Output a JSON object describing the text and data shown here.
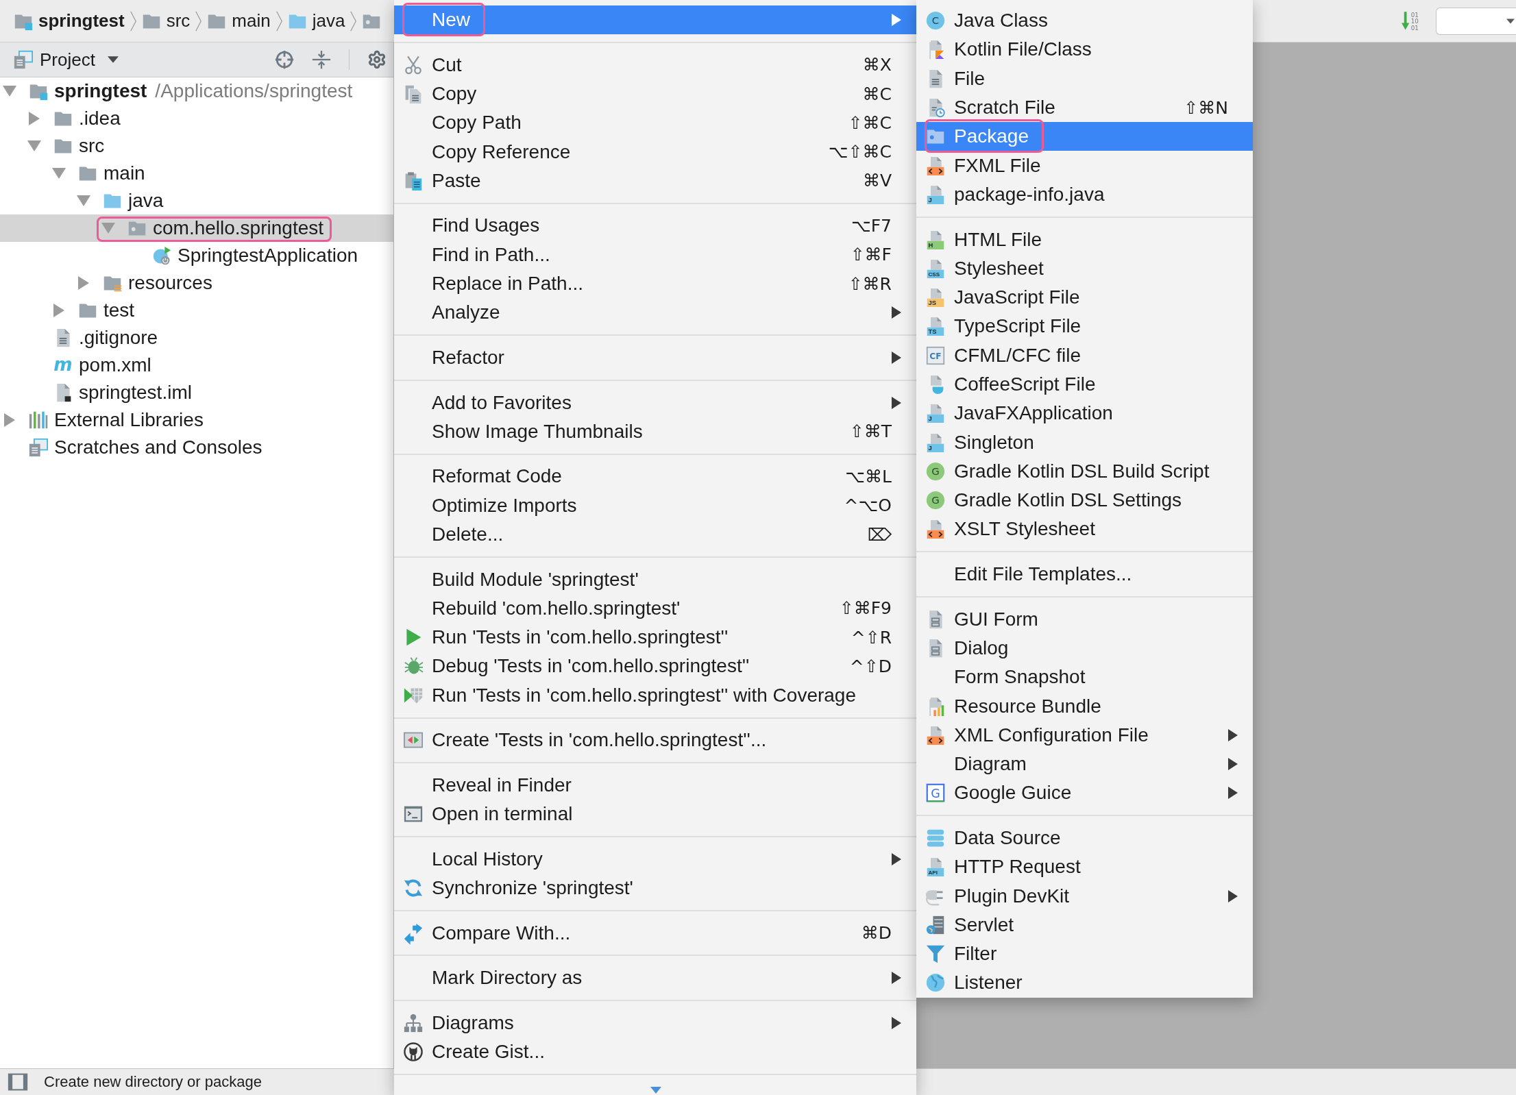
{
  "navigation_bar": {
    "breadcrumbs": [
      {
        "label": "springtest",
        "kind": "module"
      },
      {
        "label": "src",
        "kind": "folder"
      },
      {
        "label": "main",
        "kind": "folder"
      },
      {
        "label": "java",
        "kind": "source-folder"
      }
    ],
    "sort_icon_digits": [
      "01",
      "10",
      "01"
    ]
  },
  "project_panel": {
    "title": "Project",
    "tree": [
      {
        "label": "springtest",
        "path": "/Applications/springtest",
        "kind": "module",
        "expanded": true,
        "selected": false,
        "highlighted": false,
        "children": [
          {
            "label": ".idea",
            "kind": "folder",
            "expanded": false,
            "selected": false,
            "highlighted": false
          },
          {
            "label": "src",
            "kind": "folder",
            "expanded": true,
            "selected": false,
            "highlighted": false,
            "children": [
              {
                "label": "main",
                "kind": "folder",
                "expanded": true,
                "selected": false,
                "highlighted": false,
                "children": [
                  {
                    "label": "java",
                    "kind": "source-folder",
                    "expanded": true,
                    "selected": false,
                    "highlighted": false,
                    "children": [
                      {
                        "label": "com.hello.springtest",
                        "kind": "package",
                        "expanded": true,
                        "selected": true,
                        "highlighted": true,
                        "children": [
                          {
                            "label": "SpringtestApplication",
                            "kind": "spring-class",
                            "selected": false,
                            "highlighted": false
                          }
                        ]
                      }
                    ]
                  },
                  {
                    "label": "resources",
                    "kind": "resources-folder",
                    "expanded": false,
                    "selected": false,
                    "highlighted": false
                  }
                ]
              },
              {
                "label": "test",
                "kind": "folder",
                "expanded": false,
                "selected": false,
                "highlighted": false
              }
            ]
          },
          {
            "label": ".gitignore",
            "kind": "text-file",
            "selected": false,
            "highlighted": false
          },
          {
            "label": "pom.xml",
            "kind": "maven",
            "icon_label": "m",
            "selected": false,
            "highlighted": false
          },
          {
            "label": "springtest.iml",
            "kind": "module-file",
            "selected": false,
            "highlighted": false
          }
        ]
      },
      {
        "label": "External Libraries",
        "kind": "libraries",
        "expanded": false,
        "selected": false,
        "highlighted": false
      },
      {
        "label": "Scratches and Consoles",
        "kind": "scratches",
        "selected": false,
        "highlighted": false
      }
    ]
  },
  "context_menu": {
    "groups": [
      [
        {
          "label": "New",
          "submenu": true,
          "selected": true,
          "highlighted": true
        }
      ],
      [
        {
          "label": "Cut",
          "shortcut": "⌘X",
          "submenu": false,
          "selected": false,
          "highlighted": false
        },
        {
          "label": "Copy",
          "shortcut": "⌘C",
          "submenu": false,
          "selected": false,
          "highlighted": false
        },
        {
          "label": "Copy Path",
          "shortcut": "⇧⌘C",
          "submenu": false,
          "selected": false,
          "highlighted": false
        },
        {
          "label": "Copy Reference",
          "shortcut": "⌥⇧⌘C",
          "submenu": false,
          "selected": false,
          "highlighted": false
        },
        {
          "label": "Paste",
          "shortcut": "⌘V",
          "submenu": false,
          "selected": false,
          "highlighted": false
        }
      ],
      [
        {
          "label": "Find Usages",
          "shortcut": "⌥F7",
          "submenu": false,
          "selected": false,
          "highlighted": false
        },
        {
          "label": "Find in Path...",
          "shortcut": "⇧⌘F",
          "submenu": false,
          "selected": false,
          "highlighted": false
        },
        {
          "label": "Replace in Path...",
          "shortcut": "⇧⌘R",
          "submenu": false,
          "selected": false,
          "highlighted": false
        },
        {
          "label": "Analyze",
          "submenu": true,
          "selected": false,
          "highlighted": false
        }
      ],
      [
        {
          "label": "Refactor",
          "submenu": true,
          "selected": false,
          "highlighted": false
        }
      ],
      [
        {
          "label": "Add to Favorites",
          "submenu": true,
          "selected": false,
          "highlighted": false
        },
        {
          "label": "Show Image Thumbnails",
          "shortcut": "⇧⌘T",
          "submenu": false,
          "selected": false,
          "highlighted": false
        }
      ],
      [
        {
          "label": "Reformat Code",
          "shortcut": "⌥⌘L",
          "submenu": false,
          "selected": false,
          "highlighted": false
        },
        {
          "label": "Optimize Imports",
          "shortcut": "^⌥O",
          "submenu": false,
          "selected": false,
          "highlighted": false
        },
        {
          "label": "Delete...",
          "shortcut": "⌦",
          "submenu": false,
          "selected": false,
          "highlighted": false
        }
      ],
      [
        {
          "label": "Build Module 'springtest'",
          "submenu": false,
          "selected": false,
          "highlighted": false
        },
        {
          "label": "Rebuild 'com.hello.springtest'",
          "shortcut": "⇧⌘F9",
          "submenu": false,
          "selected": false,
          "highlighted": false
        },
        {
          "label": "Run 'Tests in 'com.hello.springtest''",
          "shortcut": "^⇧R",
          "submenu": false,
          "selected": false,
          "highlighted": false
        },
        {
          "label": "Debug 'Tests in 'com.hello.springtest''",
          "shortcut": "^⇧D",
          "submenu": false,
          "selected": false,
          "highlighted": false
        },
        {
          "label": "Run 'Tests in 'com.hello.springtest'' with Coverage",
          "submenu": false,
          "selected": false,
          "highlighted": false
        }
      ],
      [
        {
          "label": "Create 'Tests in 'com.hello.springtest''...",
          "submenu": false,
          "selected": false,
          "highlighted": false
        }
      ],
      [
        {
          "label": "Reveal in Finder",
          "submenu": false,
          "selected": false,
          "highlighted": false
        },
        {
          "label": "Open in terminal",
          "submenu": false,
          "selected": false,
          "highlighted": false
        }
      ],
      [
        {
          "label": "Local History",
          "submenu": true,
          "selected": false,
          "highlighted": false
        },
        {
          "label": "Synchronize 'springtest'",
          "submenu": false,
          "selected": false,
          "highlighted": false
        }
      ],
      [
        {
          "label": "Compare With...",
          "shortcut": "⌘D",
          "submenu": false,
          "selected": false,
          "highlighted": false
        }
      ],
      [
        {
          "label": "Mark Directory as",
          "submenu": true,
          "selected": false,
          "highlighted": false
        }
      ],
      [
        {
          "label": "Diagrams",
          "submenu": true,
          "selected": false,
          "highlighted": false
        },
        {
          "label": "Create Gist...",
          "submenu": false,
          "selected": false,
          "highlighted": false
        }
      ]
    ]
  },
  "new_submenu": {
    "groups": [
      [
        {
          "label": "Java Class",
          "icon_label": "C",
          "submenu": false,
          "selected": false,
          "highlighted": false
        },
        {
          "label": "Kotlin File/Class",
          "submenu": false,
          "selected": false,
          "highlighted": false
        },
        {
          "label": "File",
          "submenu": false,
          "selected": false,
          "highlighted": false
        },
        {
          "label": "Scratch File",
          "shortcut": "⇧⌘N",
          "submenu": false,
          "selected": false,
          "highlighted": false
        },
        {
          "label": "Package",
          "submenu": false,
          "selected": true,
          "highlighted": true
        },
        {
          "label": "FXML File",
          "submenu": false,
          "selected": false,
          "highlighted": false
        },
        {
          "label": "package-info.java",
          "icon_label": "J",
          "submenu": false,
          "selected": false,
          "highlighted": false
        }
      ],
      [
        {
          "label": "HTML File",
          "icon_label": "H",
          "submenu": false,
          "selected": false,
          "highlighted": false
        },
        {
          "label": "Stylesheet",
          "icon_label": "CSS",
          "submenu": false,
          "selected": false,
          "highlighted": false
        },
        {
          "label": "JavaScript File",
          "icon_label": "JS",
          "submenu": false,
          "selected": false,
          "highlighted": false
        },
        {
          "label": "TypeScript File",
          "icon_label": "TS",
          "submenu": false,
          "selected": false,
          "highlighted": false
        },
        {
          "label": "CFML/CFC file",
          "icon_label": "CF",
          "submenu": false,
          "selected": false,
          "highlighted": false
        },
        {
          "label": "CoffeeScript File",
          "submenu": false,
          "selected": false,
          "highlighted": false
        },
        {
          "label": "JavaFXApplication",
          "icon_label": "J",
          "submenu": false,
          "selected": false,
          "highlighted": false
        },
        {
          "label": "Singleton",
          "icon_label": "J",
          "submenu": false,
          "selected": false,
          "highlighted": false
        },
        {
          "label": "Gradle Kotlin DSL Build Script",
          "icon_label": "G",
          "submenu": false,
          "selected": false,
          "highlighted": false
        },
        {
          "label": "Gradle Kotlin DSL Settings",
          "icon_label": "G",
          "submenu": false,
          "selected": false,
          "highlighted": false
        },
        {
          "label": "XSLT Stylesheet",
          "submenu": false,
          "selected": false,
          "highlighted": false
        }
      ],
      [
        {
          "label": "Edit File Templates...",
          "submenu": false,
          "selected": false,
          "highlighted": false
        }
      ],
      [
        {
          "label": "GUI Form",
          "submenu": false,
          "selected": false,
          "highlighted": false
        },
        {
          "label": "Dialog",
          "submenu": false,
          "selected": false,
          "highlighted": false
        },
        {
          "label": "Form Snapshot",
          "submenu": false,
          "selected": false,
          "highlighted": false
        },
        {
          "label": "Resource Bundle",
          "submenu": false,
          "selected": false,
          "highlighted": false
        },
        {
          "label": "XML Configuration File",
          "submenu": true,
          "selected": false,
          "highlighted": false
        },
        {
          "label": "Diagram",
          "submenu": true,
          "selected": false,
          "highlighted": false
        },
        {
          "label": "Google Guice",
          "icon_label": "G",
          "submenu": true,
          "selected": false,
          "highlighted": false
        }
      ],
      [
        {
          "label": "Data Source",
          "submenu": false,
          "selected": false,
          "highlighted": false
        },
        {
          "label": "HTTP Request",
          "icon_label": "API",
          "submenu": false,
          "selected": false,
          "highlighted": false
        },
        {
          "label": "Plugin DevKit",
          "submenu": true,
          "selected": false,
          "highlighted": false
        },
        {
          "label": "Servlet",
          "submenu": false,
          "selected": false,
          "highlighted": false
        },
        {
          "label": "Filter",
          "submenu": false,
          "selected": false,
          "highlighted": false
        },
        {
          "label": "Listener",
          "submenu": false,
          "selected": false,
          "highlighted": false
        }
      ]
    ]
  },
  "status_bar": {
    "text": "Create new directory or package"
  }
}
